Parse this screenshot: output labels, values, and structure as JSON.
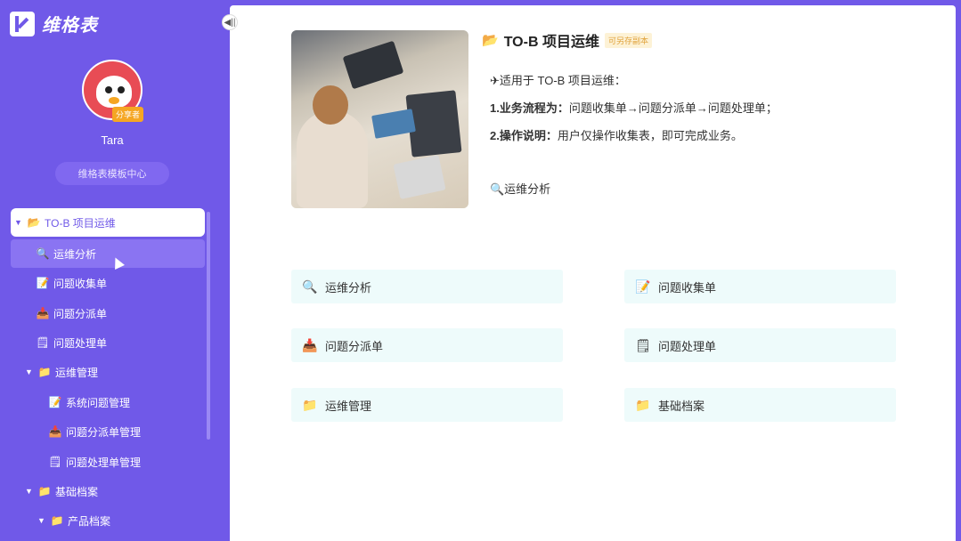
{
  "app": {
    "name": "维格表"
  },
  "user": {
    "name": "Tara",
    "badge": "分享者"
  },
  "sidebar": {
    "template_center": "维格表模板中心",
    "collapse_icon": "◀||",
    "items": [
      {
        "emoji": "📂",
        "label": "TO-B 项目运维",
        "arrow": "▼"
      },
      {
        "emoji": "🔍",
        "label": "运维分析"
      },
      {
        "emoji": "📝",
        "label": "问题收集单"
      },
      {
        "emoji": "📥",
        "label": "问题分派单"
      },
      {
        "emoji": "🗒",
        "label": "问题处理单"
      },
      {
        "emoji": "📁",
        "label": "运维管理",
        "arrow": "▼"
      },
      {
        "emoji": "📝",
        "label": "系统问题管理"
      },
      {
        "emoji": "📥",
        "label": "问题分派单管理"
      },
      {
        "emoji": "🗒",
        "label": "问题处理单管理"
      },
      {
        "emoji": "📁",
        "label": "基础档案",
        "arrow": "▼"
      },
      {
        "emoji": "📁",
        "label": "产品档案",
        "arrow": "▼"
      }
    ]
  },
  "project": {
    "emoji": "📂",
    "title": "TO-B 项目运维",
    "copy_badge": "可另存副本",
    "intro": "✈适用于 TO-B 项目运维：",
    "flow_label": "1.业务流程为：",
    "flow_text": "问题收集单→问题分派单→问题处理单；",
    "op_label": "2.操作说明：",
    "op_text": "用户仅操作收集表，即可完成业务。",
    "analysis": "🔍运维分析"
  },
  "cards": [
    {
      "emoji": "🔍",
      "label": "运维分析"
    },
    {
      "emoji": "📝",
      "label": "问题收集单"
    },
    {
      "emoji": "📥",
      "label": "问题分派单"
    },
    {
      "emoji": "🗒",
      "label": "问题处理单"
    },
    {
      "emoji": "📁",
      "label": "运维管理"
    },
    {
      "emoji": "📁",
      "label": "基础档案"
    }
  ],
  "colors": {
    "sidebar": "#7059e8",
    "card_bg": "#eefbfb",
    "badge": "#f5a623"
  }
}
